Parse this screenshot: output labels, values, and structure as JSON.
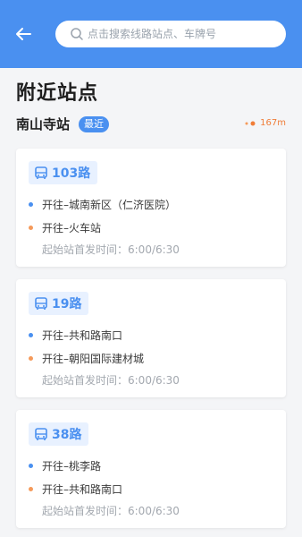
{
  "header": {
    "search_placeholder": "点击搜索线路站点、车牌号"
  },
  "page": {
    "title": "附近站点",
    "station": {
      "name": "南山寺站",
      "badge": "最近",
      "distance": "167m"
    }
  },
  "routes": [
    {
      "name": "103路",
      "dir1": "开往–城南新区（仁济医院）",
      "dir2": "开往–火车站",
      "first_time": "起始站首发时间：6:00/6:30"
    },
    {
      "name": "19路",
      "dir1": "开往–共和路南口",
      "dir2": "开往–朝阳国际建材城",
      "first_time": "起始站首发时间：6:00/6:30"
    },
    {
      "name": "38路",
      "dir1": "开往–桃李路",
      "dir2": "开往–共和路南口",
      "first_time": "起始站首发时间：6:00/6:30"
    }
  ],
  "colors": {
    "primary": "#4a90f0",
    "accent": "#f07d38"
  },
  "icons": {
    "back": "arrow-left-icon",
    "search": "search-icon",
    "bus": "bus-icon",
    "distance": "location-dots-icon"
  }
}
